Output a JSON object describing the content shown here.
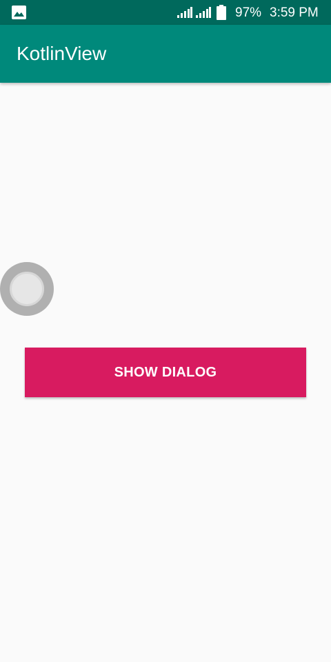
{
  "status_bar": {
    "battery": "97%",
    "time": "3:59 PM",
    "icons": [
      "gallery-notification-icon",
      "signal-icon",
      "signal-icon",
      "battery-icon"
    ]
  },
  "app_bar": {
    "title": "KotlinView"
  },
  "main": {
    "button_label": "SHOW DIALOG"
  },
  "colors": {
    "status_bar": "#00695c",
    "app_bar": "#00897b",
    "accent": "#d81b60",
    "background": "#fafafa"
  }
}
